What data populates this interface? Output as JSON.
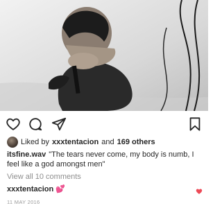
{
  "post": {
    "image_alt": "",
    "likes": {
      "prefix": "Liked by",
      "user": "xxxtentacion",
      "middle": "and",
      "others": "169 others"
    },
    "caption": {
      "username": "itsfine.wav",
      "text": "\"The tears never come, my body is numb, I feel like a god amongst men\""
    },
    "view_all_comments": "View all 10 comments",
    "comments": [
      {
        "username": "xxxtentacion",
        "text": "💕",
        "liked": true
      }
    ],
    "date": "11 MAY 2016"
  },
  "icons": {
    "like": "heart-outline-icon",
    "comment": "comment-bubble-icon",
    "share": "paper-plane-icon",
    "save": "bookmark-icon",
    "comment_like": "heart-filled-icon"
  },
  "colors": {
    "text": "#262626",
    "muted": "#8e8e8e",
    "like_red": "#ed4956",
    "emoji_pink": "#e040a0"
  }
}
